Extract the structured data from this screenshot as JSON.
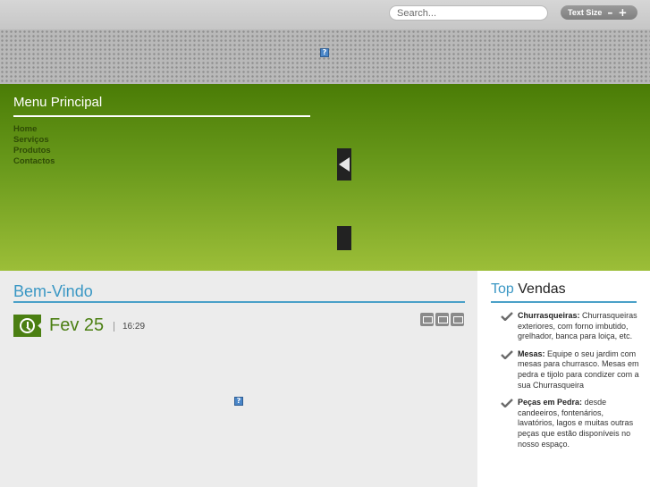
{
  "header": {
    "search_placeholder": "Search...",
    "text_size_label": "Text Size",
    "text_size_decrease": "–",
    "text_size_increase": "+"
  },
  "broken_image_glyph": "?",
  "menu": {
    "title_first": "Menu",
    "title_second": "Principal",
    "items": [
      "Home",
      "Serviços",
      "Produtos",
      "Contactos"
    ]
  },
  "main": {
    "title": "Bem-Vindo",
    "date": "Fev 25",
    "time": "16:29"
  },
  "sidebar": {
    "title_first": "Top",
    "title_second": "Vendas",
    "items": [
      {
        "heading": "Churrasqueiras:",
        "text": "Churrasqueiras exteriores, com forno imbutido, grelhador, banca para loiça, etc."
      },
      {
        "heading": "Mesas:",
        "text": "Equipe o seu jardim com mesas para churrasco. Mesas em pedra e tijolo para condizer com a sua Churrasqueira"
      },
      {
        "heading": "Peças em Pedra:",
        "text": "desde candeeiros, fontenários, lavatórios, lagos e muitas outras peças que estão disponíveis no nosso espaço."
      }
    ]
  },
  "colors": {
    "accent_blue": "#3a97c4",
    "green_dark": "#4a7c06",
    "green_light": "#9cbe38"
  },
  "icons": {
    "date": "clock-icon",
    "tools": [
      "comment-icon",
      "print-icon",
      "email-icon"
    ],
    "bullet": "checkmark-icon"
  }
}
